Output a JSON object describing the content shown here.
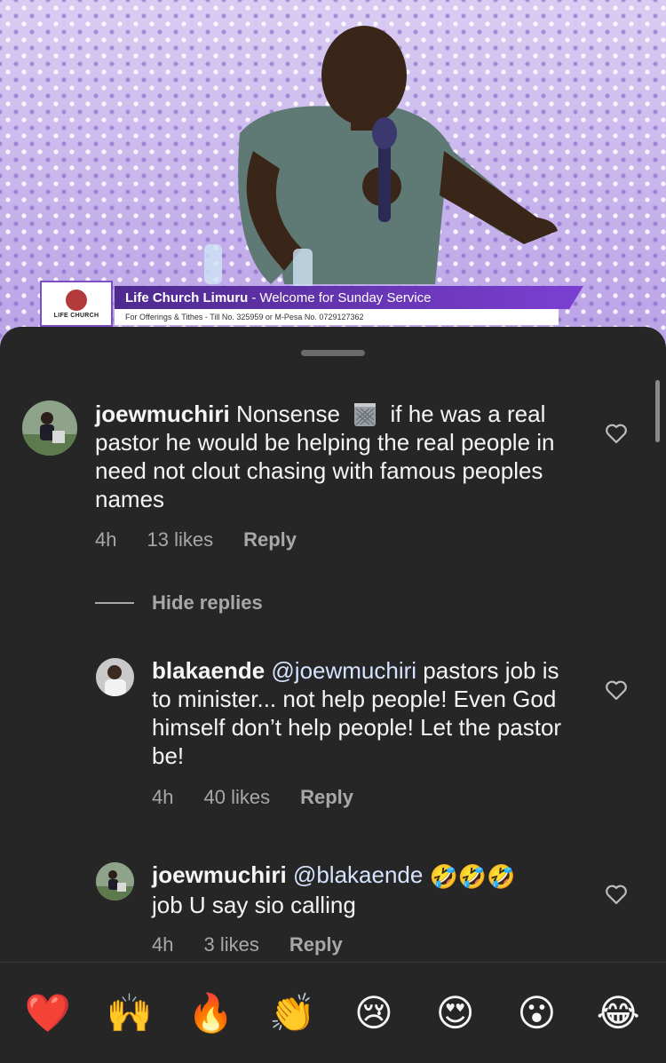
{
  "video": {
    "banner_logo_text": "LIFE CHURCH",
    "banner_title": "Life Church Limuru",
    "banner_separator": "-",
    "banner_welcome": "Welcome for Sunday Service",
    "banner_sub": "For Offerings & Tithes - Till No. 325959 or M-Pesa No. 0729127362"
  },
  "comments": [
    {
      "username": "joewmuchiri",
      "text_part1": "Nonsense",
      "text_part2": "if he was a real pastor he would be helping the real people in need not clout chasing with famous peoples names",
      "time": "4h",
      "likes": "13 likes",
      "reply_label": "Reply"
    },
    {
      "username": "blakaende",
      "mention": "@joewmuchiri",
      "text": "pastors job is to minister... not help people! Even God himself don’t help people! Let the pastor be!",
      "time": "4h",
      "likes": "40 likes",
      "reply_label": "Reply"
    },
    {
      "username": "joewmuchiri",
      "mention": "@blakaende",
      "emoji": "🤣🤣🤣",
      "text": "job U say sio calling",
      "time": "4h",
      "likes": "3 likes",
      "reply_label": "Reply"
    }
  ],
  "hide_replies_label": "Hide replies",
  "reactions": [
    "❤️",
    "🙌",
    "🔥",
    "👏",
    "😢",
    "😍",
    "😮",
    "😂"
  ],
  "icons": {
    "like": "heart-outline-icon",
    "trash": "wastebasket-emoji"
  },
  "colors": {
    "background": "#262626",
    "secondary_text": "#a8a8a8",
    "banner_purple": "#7b3fd2"
  }
}
